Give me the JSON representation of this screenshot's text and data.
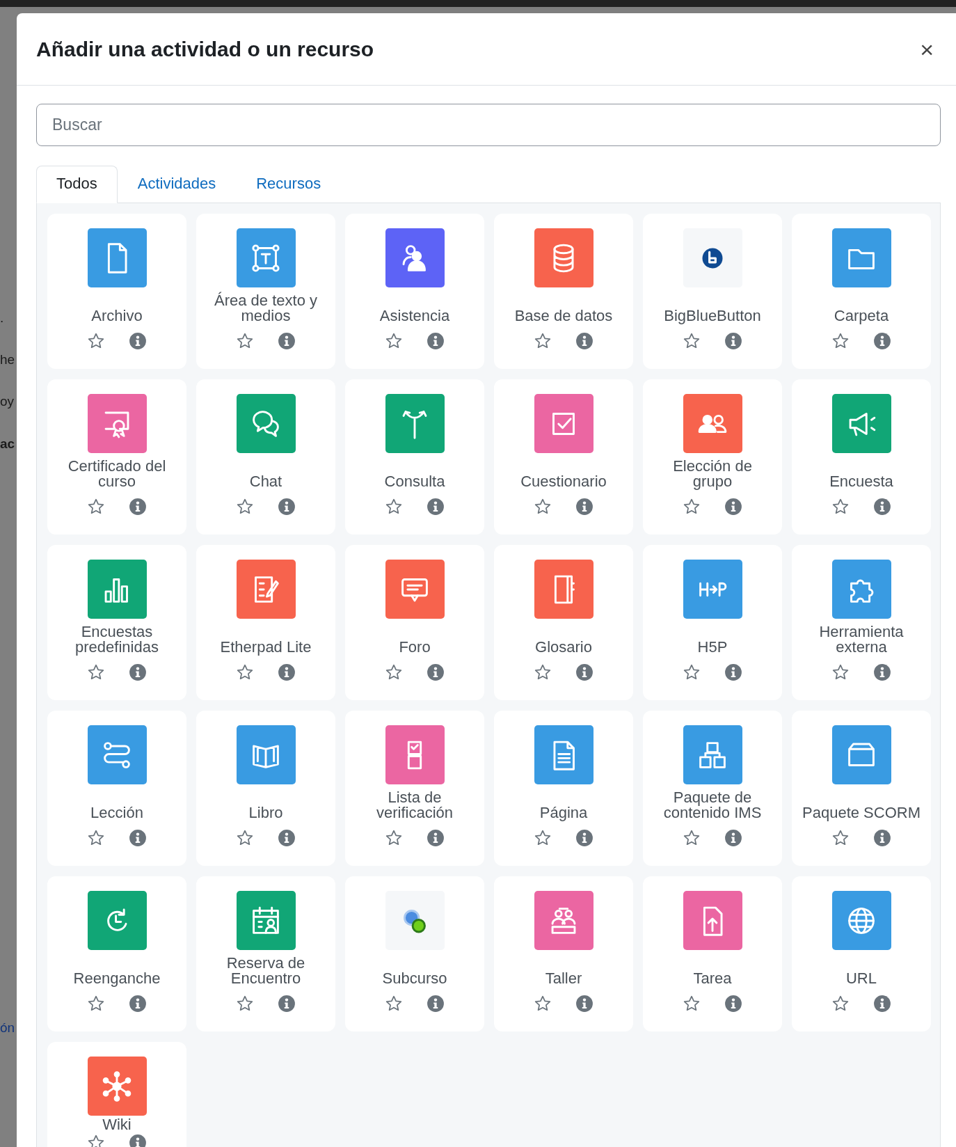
{
  "backdrop": {
    "fragments": [
      ".",
      "he",
      "oy",
      "ac",
      "ón"
    ]
  },
  "dialog": {
    "title": "Añadir una actividad o un recurso",
    "close": "×"
  },
  "search": {
    "placeholder": "Buscar"
  },
  "tabs": [
    {
      "label": "Todos",
      "selected": true
    },
    {
      "label": "Actividades",
      "selected": false
    },
    {
      "label": "Recursos",
      "selected": false
    }
  ],
  "items": [
    {
      "label": "Archivo",
      "kind": "document",
      "color": "#399be2",
      "starred": false
    },
    {
      "label": "Área de texto y medios",
      "kind": "frame",
      "color": "#399be2",
      "starred": false
    },
    {
      "label": "Asistencia",
      "kind": "people",
      "color": "#5d63f6",
      "starred": false
    },
    {
      "label": "Base de datos",
      "kind": "database",
      "color": "#f7634d",
      "starred": false
    },
    {
      "label": "BigBlueButton",
      "kind": "logo",
      "color": "#f5f7f9",
      "starred": false
    },
    {
      "label": "Carpeta",
      "kind": "folder",
      "color": "#399be2",
      "starred": false
    },
    {
      "label": "Certificado del curso",
      "kind": "certificate",
      "color": "#eb66a2",
      "starred": false
    },
    {
      "label": "Chat",
      "kind": "bubbles",
      "color": "#11a676",
      "starred": false
    },
    {
      "label": "Consulta",
      "kind": "signpost",
      "color": "#11a676",
      "starred": false
    },
    {
      "label": "Cuestionario",
      "kind": "checkbox",
      "color": "#eb66a2",
      "starred": false
    },
    {
      "label": "Elección de grupo",
      "kind": "group",
      "color": "#f7634d",
      "starred": false
    },
    {
      "label": "Encuesta",
      "kind": "megaphone",
      "color": "#11a676",
      "starred": false
    },
    {
      "label": "Encuestas predefinidas",
      "kind": "bars",
      "color": "#11a676",
      "starred": false
    },
    {
      "label": "Etherpad Lite",
      "kind": "pad",
      "color": "#f7634d",
      "starred": false
    },
    {
      "label": "Foro",
      "kind": "speech",
      "color": "#f7634d",
      "starred": false
    },
    {
      "label": "Glosario",
      "kind": "notebook",
      "color": "#f7634d",
      "starred": false
    },
    {
      "label": "H5P",
      "kind": "arrows",
      "color": "#399be2",
      "starred": false
    },
    {
      "label": "Herramienta externa",
      "kind": "puzzle",
      "color": "#399be2",
      "starred": false
    },
    {
      "label": "Lección",
      "kind": "route",
      "color": "#399be2",
      "starred": false
    },
    {
      "label": "Libro",
      "kind": "book",
      "color": "#399be2",
      "starred": false
    },
    {
      "label": "Lista de verificación",
      "kind": "checklist",
      "color": "#eb66a2",
      "starred": false
    },
    {
      "label": "Página",
      "kind": "page",
      "color": "#399be2",
      "starred": false
    },
    {
      "label": "Paquete de contenido IMS",
      "kind": "blocks",
      "color": "#399be2",
      "starred": false
    },
    {
      "label": "Paquete SCORM",
      "kind": "box",
      "color": "#399be2",
      "starred": false
    },
    {
      "label": "Reenganche",
      "kind": "clock",
      "color": "#11a676",
      "starred": false
    },
    {
      "label": "Reserva de Encuentro",
      "kind": "calendar",
      "color": "#11a676",
      "starred": false
    },
    {
      "label": "Subcurso",
      "kind": "dots",
      "color": "#f5f7f9",
      "starred": false
    },
    {
      "label": "Taller",
      "kind": "team",
      "color": "#eb66a2",
      "starred": false
    },
    {
      "label": "Tarea",
      "kind": "upload",
      "color": "#eb66a2",
      "starred": false
    },
    {
      "label": "URL",
      "kind": "globe",
      "color": "#399be2",
      "starred": false
    },
    {
      "label": "Wiki",
      "kind": "network",
      "color": "#f7634d",
      "starred": false
    }
  ]
}
